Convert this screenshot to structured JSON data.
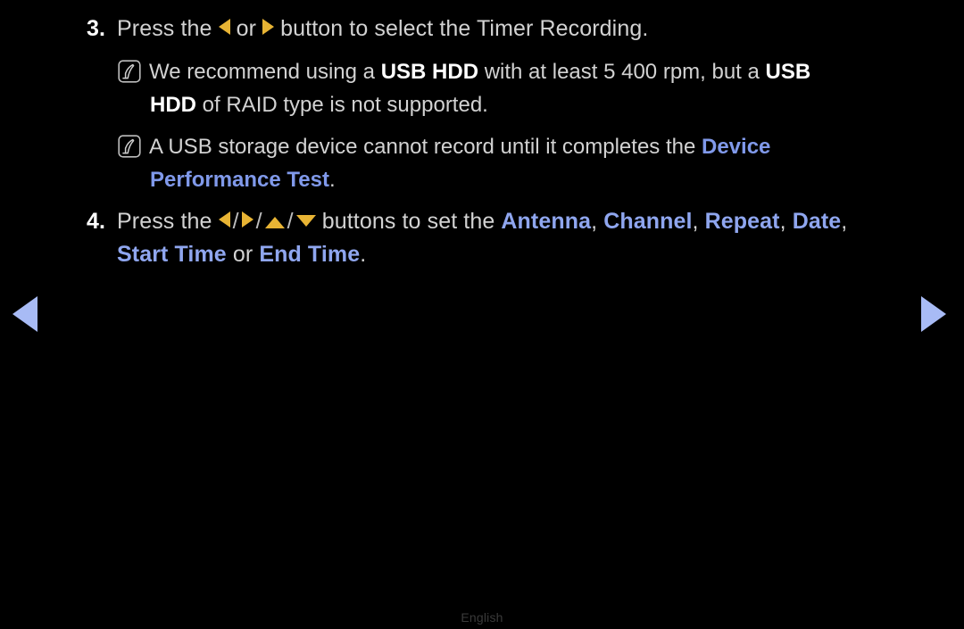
{
  "page": {
    "background_color": "#000000",
    "text_color": "#d2d2d2",
    "accent_blue": "#8099ea",
    "accent_amber": "#e8b434",
    "nav_arrow_color": "#a8bbf5"
  },
  "steps": [
    {
      "number": "3.",
      "lead": "Press the",
      "icon_left": "triangle-left-icon",
      "conjunction": "or",
      "icon_right": "triangle-right-icon",
      "tail": "button to select the Timer Recording."
    },
    {
      "number": "4.",
      "lead": "Press the",
      "icons": [
        "triangle-left-icon",
        "triangle-right-icon",
        "triangle-up-icon",
        "triangle-down-icon"
      ],
      "separator": "/",
      "middle": "buttons to set the",
      "terms": [
        "Antenna",
        "Channel",
        "Repeat",
        "Date",
        "Start Time",
        "End Time"
      ],
      "comma": ",",
      "or_word": "or",
      "period": "."
    }
  ],
  "notes": [
    {
      "icon": "note-pencil-icon",
      "line1_pre": "We recommend using a ",
      "line1_bold1": "USB HDD",
      "line1_mid": " with at least 5 400 rpm, but a ",
      "line1_bold2": "USB",
      "line2_bold": "HDD",
      "line2_tail": " of RAID type is not supported."
    },
    {
      "icon": "note-pencil-icon",
      "line1_pre": "A USB storage device cannot record until it completes the ",
      "line1_link": "Device",
      "line2_link": "Performance Test",
      "line2_tail": "."
    }
  ],
  "nav": {
    "prev_label": "previous-page",
    "next_label": "next-page"
  },
  "footer": {
    "language": "English"
  }
}
